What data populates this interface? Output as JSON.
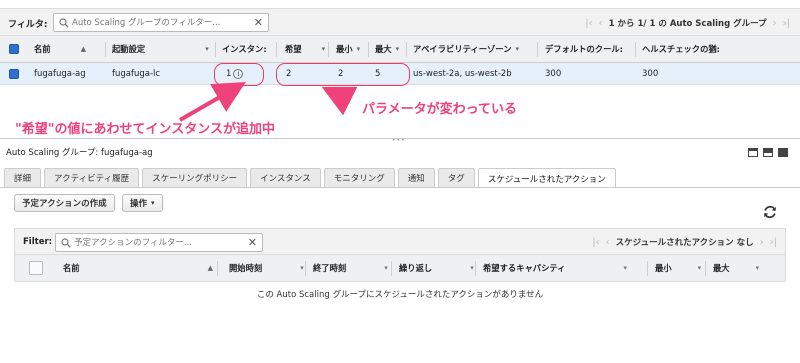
{
  "top": {
    "filter_label": "フィルタ:",
    "search_placeholder": "Auto Scaling グループのフィルター...",
    "pager_text": "1 から 1/ 1 の Auto Scaling グループ",
    "columns": [
      "名前",
      "起動設定",
      "インスタン:",
      "希望",
      "最小",
      "最大",
      "アベイラビリティーゾーン",
      "デフォルトのクール:",
      "ヘルスチェックの猶:"
    ],
    "row": {
      "name": "fugafuga-ag",
      "launch_config": "fugafuga-lc",
      "instances": "1",
      "desired": "2",
      "min": "2",
      "max": "5",
      "zones": "us-west-2a, us-west-2b",
      "cooldown": "300",
      "health_grace": "300"
    }
  },
  "annotations": {
    "params_changed": "パラメータが変わっている",
    "instances_added": "\"希望\"の値にあわせてインスタンスが追加中",
    "color": "#f0427a"
  },
  "detail": {
    "title": "Auto Scaling グループ: fugafuga-ag",
    "tabs": [
      "詳細",
      "アクティビティ履歴",
      "スケーリングポリシー",
      "インスタンス",
      "モニタリング",
      "通知",
      "タグ",
      "スケジュールされたアクション"
    ],
    "active_tab": "スケジュールされたアクション",
    "create_button": "予定アクションの作成",
    "actions_button": "操作",
    "filter_label": "Filter:",
    "search_placeholder": "予定アクションのフィルター...",
    "pager_text": "スケジュールされたアクション なし",
    "columns": [
      "名前",
      "開始時刻",
      "終了時刻",
      "繰り返し",
      "希望するキャパシティ",
      "最小",
      "最大"
    ],
    "empty_message": "この Auto Scaling グループにスケジュールされたアクションがありません"
  }
}
